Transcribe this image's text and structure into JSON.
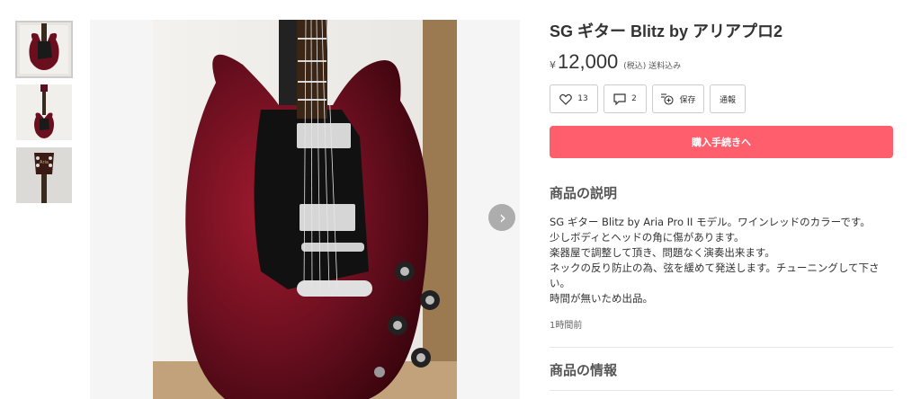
{
  "thumbnails": [
    {
      "alt": "guitar-thumbnail-1"
    },
    {
      "alt": "guitar-thumbnail-2"
    },
    {
      "alt": "guitar-thumbnail-3"
    }
  ],
  "product": {
    "title": "SG ギター Blitz by アリアプロ2",
    "currency": "¥",
    "price": "12,000",
    "tax_note": "(税込) 送料込み"
  },
  "actions": {
    "like_count": "13",
    "comment_count": "2",
    "save_label": "保存",
    "report_label": "通報"
  },
  "buy_button": "購入手続きへ",
  "description": {
    "heading": "商品の説明",
    "text": "SG ギター Blitz by Aria Pro II モデル。ワインレッドのカラーです。\n少しボディとヘッドの角に傷があります。\n楽器屋で調整して頂き、問題なく演奏出来ます。\nネックの反り防止の為、弦を緩めて発送します。チューニングして下さい。\n時間が無いため出品。",
    "posted": "1時間前"
  },
  "info": {
    "heading": "商品の情報"
  },
  "colors": {
    "accent": "#ff5f6d",
    "body_wine": "#6b0f1f",
    "pickguard": "#111111"
  },
  "icons": {
    "like": "heart-icon",
    "comment": "comment-icon",
    "save": "save-icon",
    "next": "chevron-right-icon"
  }
}
